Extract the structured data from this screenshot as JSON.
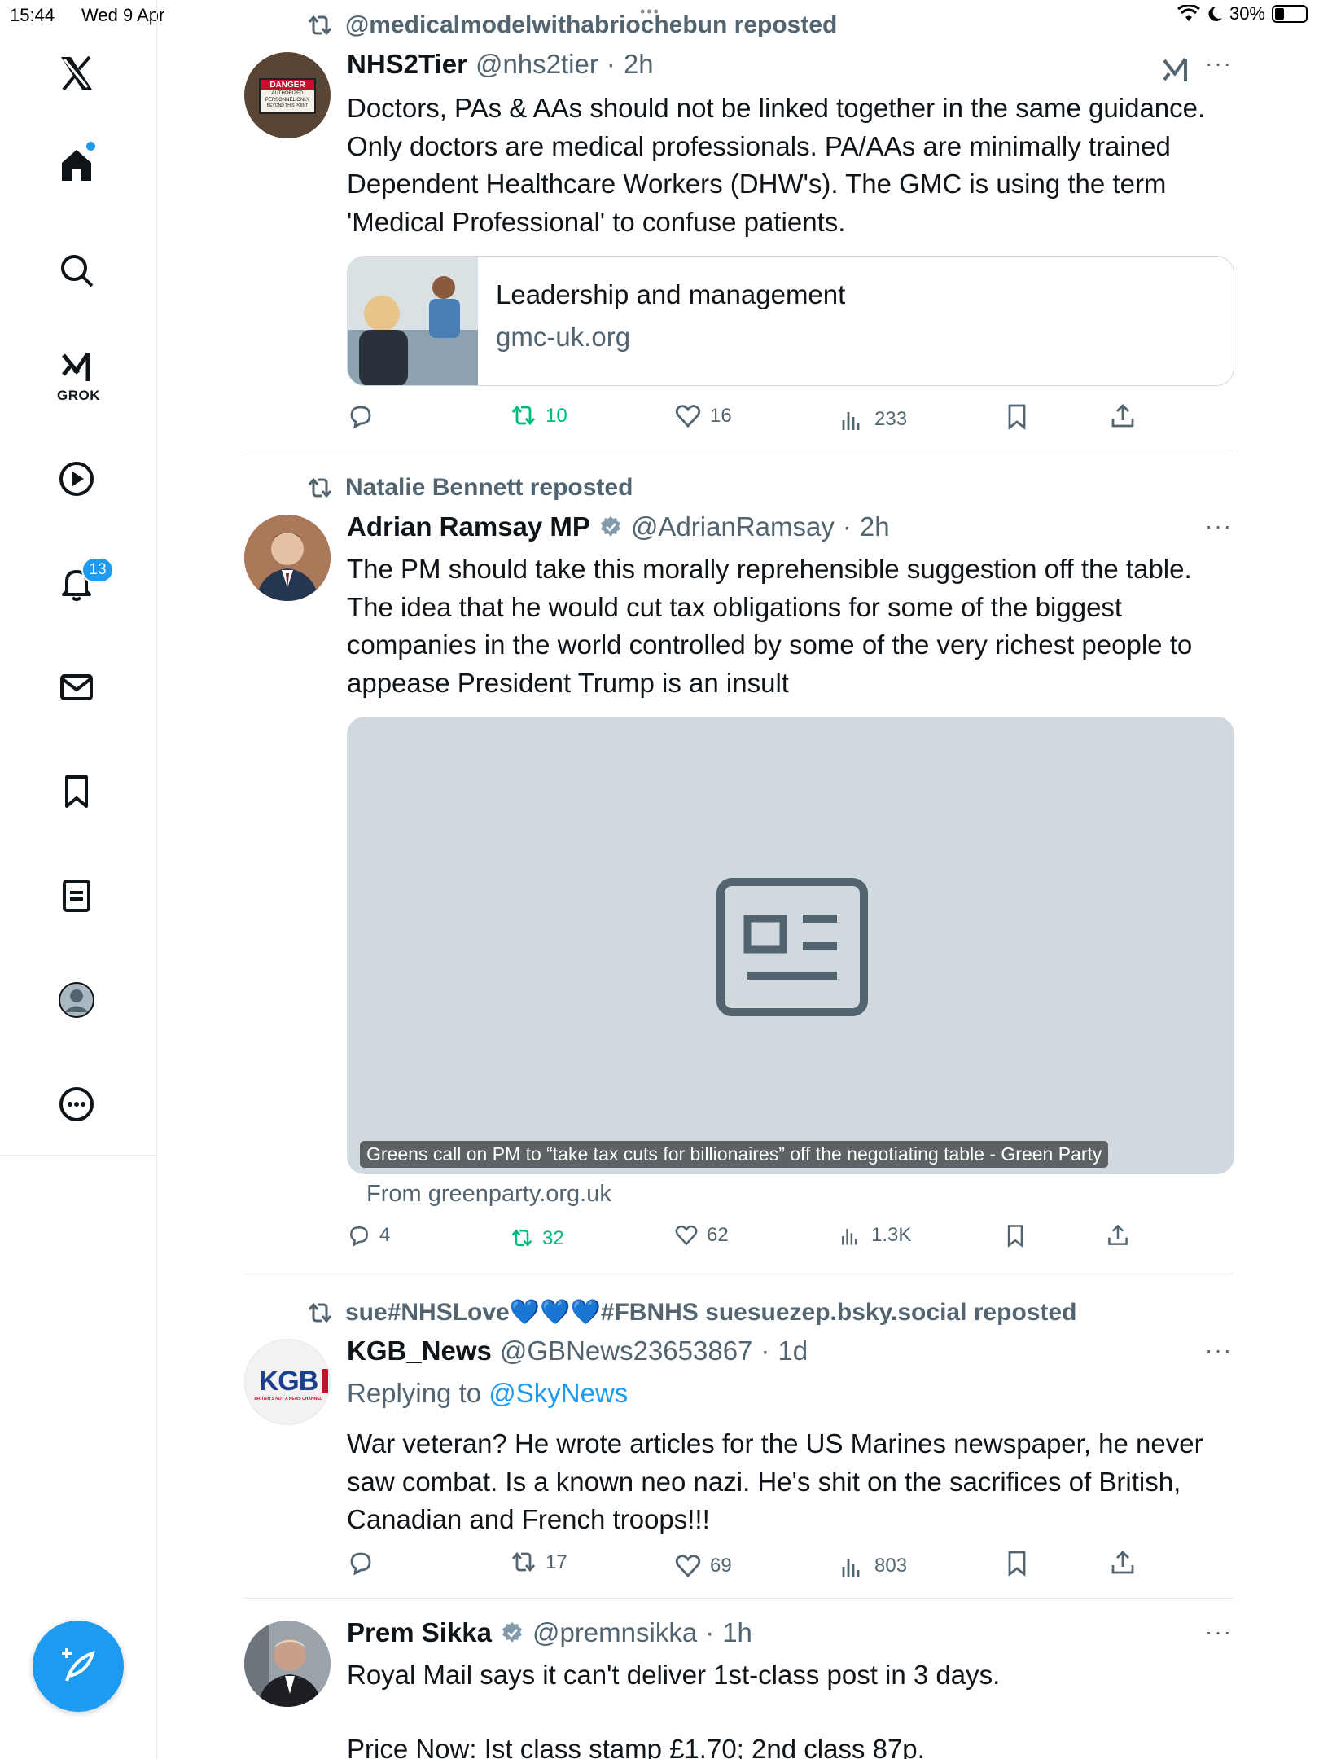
{
  "status_bar": {
    "time": "15:44",
    "date": "Wed 9 Apr",
    "battery": "30%",
    "battery_level": 0.3
  },
  "sidebar": {
    "grok_label": "GROK",
    "notifications_count": "13"
  },
  "tweets": [
    {
      "repost_by": "@medicalmodelwithabriochebun reposted",
      "name": "NHS2Tier",
      "handle": "@nhs2tier",
      "time": "2h",
      "text_lines": [
        "Doctors, PAs & AAs should not be linked together in the same guidance.",
        "Only doctors are medical professionals. PA/AAs are minimally trained",
        "Dependent Healthcare Workers (DHW's). The GMC  is using the term",
        "'Medical Professional' to confuse patients."
      ],
      "avatar_sign": [
        "DANGER",
        "AUTHORIZED",
        "PERSONNEL ONLY",
        "BEYOND THIS POINT"
      ],
      "card": {
        "title": "Leadership and management",
        "domain": "gmc-uk.org"
      },
      "stats": {
        "replies": "",
        "reposts": "10",
        "likes": "16",
        "views": "233"
      }
    },
    {
      "repost_by": "Natalie Bennett reposted",
      "name": "Adrian Ramsay MP",
      "handle": "@AdrianRamsay",
      "time": "2h",
      "text_lines": [
        "The PM should take this morally reprehensible suggestion off the table.",
        "The idea that he would cut tax obligations for some of the biggest",
        "companies in the world controlled by some of the very richest people to",
        "appease President Trump is an insult"
      ],
      "image_caption": "Greens call on PM to “take tax cuts for billionaires” off the negotiating table - Green Party",
      "from": "From greenparty.org.uk",
      "stats": {
        "replies": "4",
        "reposts": "32",
        "likes": "62",
        "views": "1.3K"
      }
    },
    {
      "repost_by": "sue#NHSLove💙💙💙#FBNHS suesuezep.bsky.social reposted",
      "name": "KGB_News",
      "handle": "@GBNews23653867",
      "time": "1d",
      "replying_prefix": "Replying to",
      "replying_to": "@SkyNews",
      "avatar_text": "KGB",
      "avatar_subtext": "BRITAIN'S NOT A NEWS CHANNEL",
      "text_lines": [
        "War veteran? He wrote articles for the US Marines newspaper, he never",
        "saw combat. Is a known neo nazi. He's shit on the sacrifices of British,",
        "Canadian and French troops!!!"
      ],
      "stats": {
        "replies": "",
        "reposts": "17",
        "likes": "69",
        "views": "803"
      }
    },
    {
      "name": "Prem Sikka",
      "handle": "@premnsikka",
      "time": "1h",
      "text_lines": [
        "Royal Mail says it can't deliver 1st-class post in 3 days.",
        "",
        "Price Now: Ist class stamp £1.70; 2nd class 87p."
      ]
    }
  ],
  "colors": {
    "accent": "#1d9bf0",
    "secondary_text": "#536471",
    "repost_green": "#00ba7c"
  }
}
